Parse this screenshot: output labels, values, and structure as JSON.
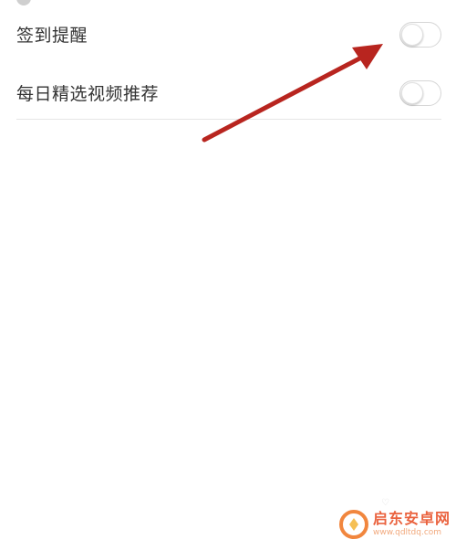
{
  "settings": {
    "items": [
      {
        "label": "签到提醒",
        "enabled": false
      },
      {
        "label": "每日精选视频推荐",
        "enabled": false
      }
    ]
  },
  "watermark": {
    "title": "启东安卓网",
    "url": "www.qdltdq.com"
  },
  "colors": {
    "arrow": "#b8251f",
    "watermark": "#e8522a",
    "toggle_border": "#d6d6d6"
  }
}
